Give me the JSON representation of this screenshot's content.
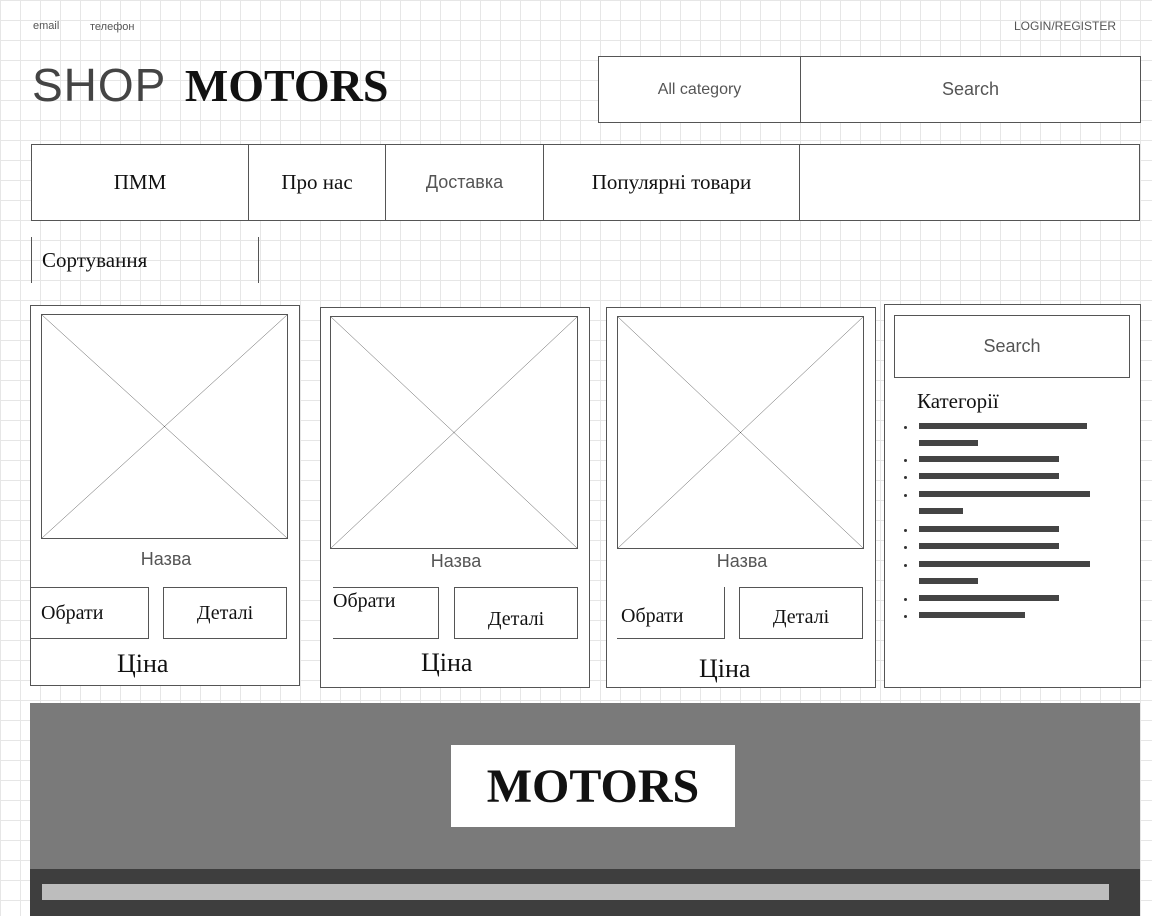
{
  "topbar": {
    "email": "email",
    "phone": "телефон",
    "login": "LOGIN/REGISTER"
  },
  "logo": {
    "shop": "SHOP",
    "motors": "MOTORS"
  },
  "header_search": {
    "category": "All category",
    "search": "Search"
  },
  "nav": {
    "items": [
      {
        "label": "ПММ"
      },
      {
        "label": "Про нас"
      },
      {
        "label": "Доставка"
      },
      {
        "label": "Популярні товари"
      }
    ]
  },
  "sort": {
    "label": "Сортування"
  },
  "products": [
    {
      "name": "Назва",
      "select": "Обрати",
      "details": "Деталі",
      "price": "Ціна"
    },
    {
      "name": "Назва",
      "select": "Обрати",
      "details": "Деталі",
      "price": "Ціна"
    },
    {
      "name": "Назва",
      "select": "Обрати",
      "details": "Деталі",
      "price": "Ціна"
    }
  ],
  "sidebar": {
    "search": "Search",
    "categories_title": "Категорії"
  },
  "footer": {
    "brand": "MOTORS"
  }
}
